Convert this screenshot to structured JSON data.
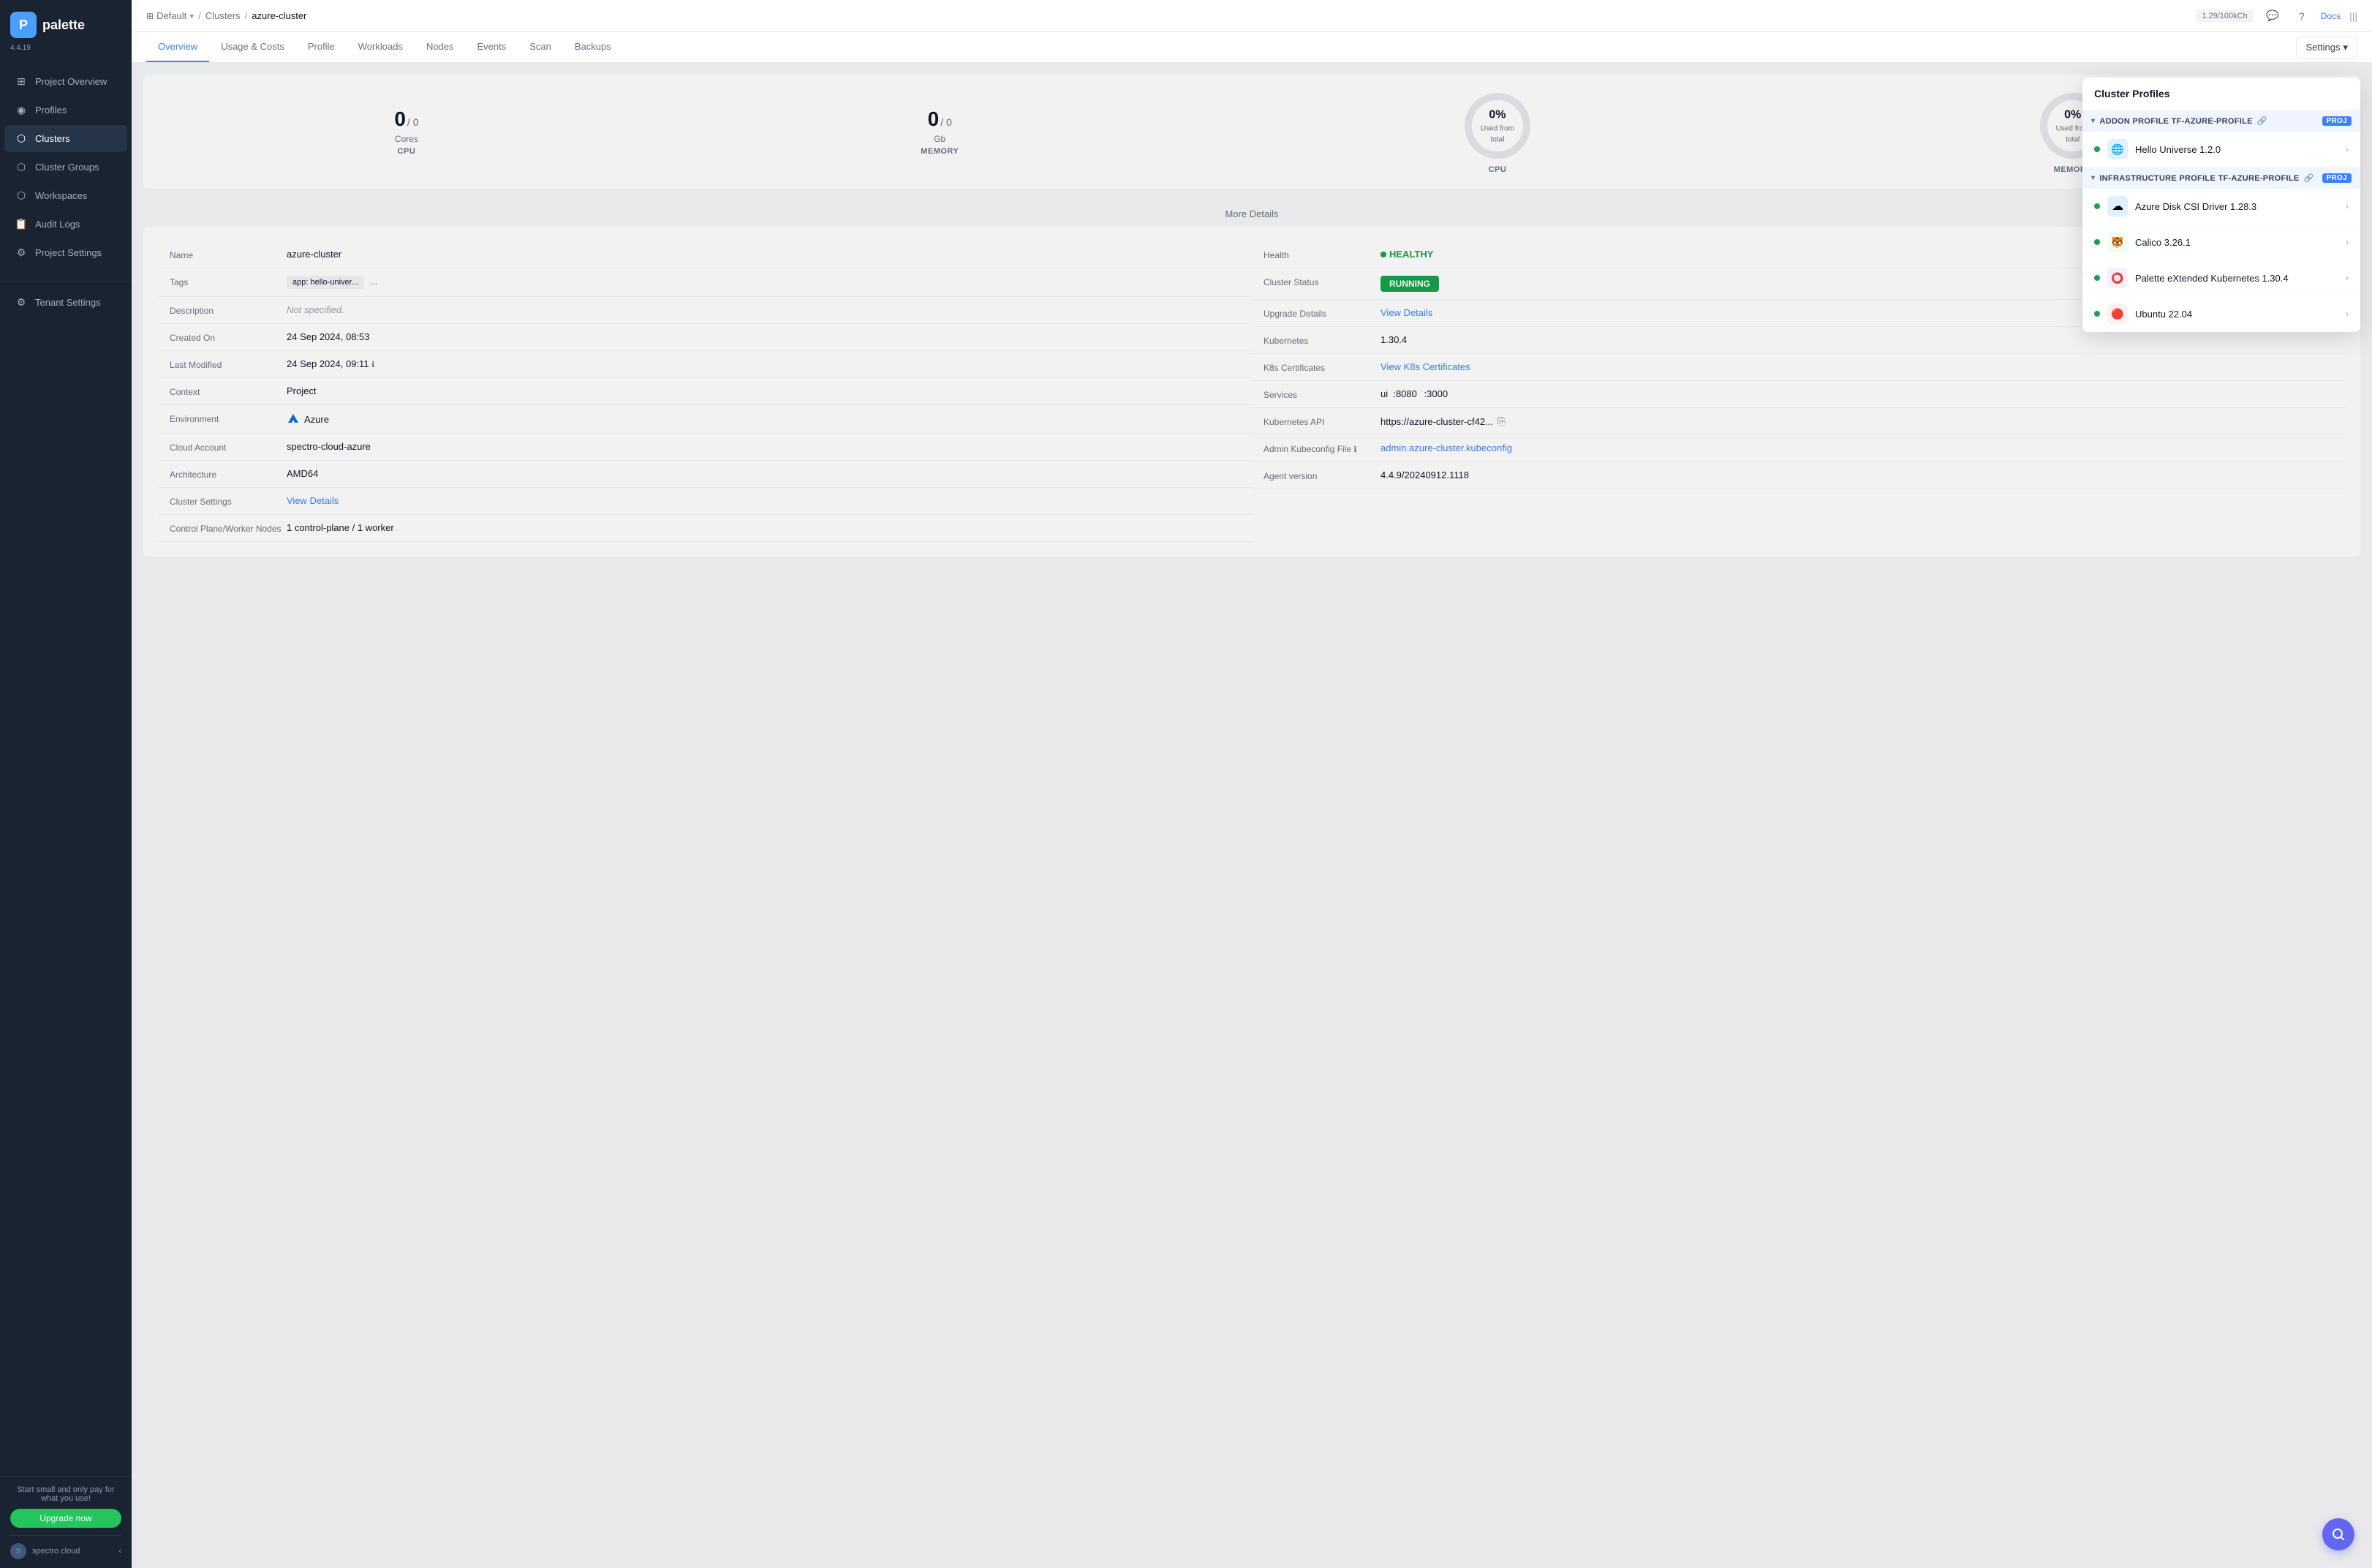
{
  "app": {
    "version": "4.4.19",
    "logo_letter": "P",
    "logo_text": "palette"
  },
  "sidebar": {
    "items": [
      {
        "id": "project-overview",
        "label": "Project Overview",
        "icon": "⊞"
      },
      {
        "id": "profiles",
        "label": "Profiles",
        "icon": "◉"
      },
      {
        "id": "clusters",
        "label": "Clusters",
        "icon": "⬡"
      },
      {
        "id": "cluster-groups",
        "label": "Cluster Groups",
        "icon": "⬡"
      },
      {
        "id": "workspaces",
        "label": "Workspaces",
        "icon": "⬡"
      },
      {
        "id": "audit-logs",
        "label": "Audit Logs",
        "icon": "📋"
      },
      {
        "id": "project-settings",
        "label": "Project Settings",
        "icon": "⚙"
      }
    ],
    "active_item": "clusters",
    "bottom": {
      "upgrade_text": "Start small and only pay for what you use!",
      "upgrade_btn": "Upgrade now",
      "spectro_label": "spectro cloud"
    },
    "tenant_settings": "Tenant Settings"
  },
  "topbar": {
    "workspace": "Default",
    "breadcrumb_clusters": "Clusters",
    "breadcrumb_current": "azure-cluster",
    "credits": "1.29/100kCh",
    "docs_label": "Docs"
  },
  "tabs": {
    "items": [
      "Overview",
      "Usage & Costs",
      "Profile",
      "Workloads",
      "Nodes",
      "Events",
      "Scan",
      "Backups"
    ],
    "active": "Overview",
    "settings_label": "Settings"
  },
  "overview": {
    "cpu_cores": "0",
    "cpu_total": "0",
    "cpu_unit": "Cores",
    "cpu_label": "CPU",
    "mem_gb": "0",
    "mem_total": "0",
    "mem_unit": "Gb",
    "mem_label": "MEMORY",
    "cpu_donut_pct": "0%",
    "cpu_donut_sub": "Used from total",
    "cpu_donut_label": "CPU",
    "mem_donut_pct": "0%",
    "mem_donut_sub": "Used from total",
    "mem_donut_label": "MEMORY",
    "more_details": "More Details"
  },
  "details": {
    "left": [
      {
        "label": "Name",
        "value": "azure-cluster",
        "type": "text"
      },
      {
        "label": "Tags",
        "value": "app: hello-univer...",
        "type": "tags"
      },
      {
        "label": "Description",
        "value": "Not specified.",
        "type": "gray"
      },
      {
        "label": "Created On",
        "value": "24 Sep 2024, 08:53",
        "type": "text"
      },
      {
        "label": "Last Modified",
        "value": "24 Sep 2024, 09:11",
        "type": "info"
      },
      {
        "label": "Context",
        "value": "Project",
        "type": "text"
      },
      {
        "label": "Environment",
        "value": "Azure",
        "type": "azure"
      },
      {
        "label": "Cloud Account",
        "value": "spectro-cloud-azure",
        "type": "text"
      },
      {
        "label": "Architecture",
        "value": "AMD64",
        "type": "text"
      },
      {
        "label": "Cluster Settings",
        "value": "View Details",
        "type": "link"
      },
      {
        "label": "Control Plane/Worker Nodes",
        "value": "1 control-plane / 1 worker",
        "type": "text"
      }
    ],
    "right": [
      {
        "label": "Health",
        "value": "HEALTHY",
        "type": "healthy"
      },
      {
        "label": "Cluster Status",
        "value": "RUNNING",
        "type": "status"
      },
      {
        "label": "Upgrade Details",
        "value": "View Details",
        "type": "link"
      },
      {
        "label": "Kubernetes",
        "value": "1.30.4",
        "type": "text"
      },
      {
        "label": "K8s Certificates",
        "value": "View K8s Certificates",
        "type": "link"
      },
      {
        "label": "Services",
        "value": "ui  :8080  :3000",
        "type": "text"
      },
      {
        "label": "Kubernetes API",
        "value": "https://azure-cluster-cf42...",
        "type": "copy"
      },
      {
        "label": "Admin Kubeconfig File",
        "value": "admin.azure-cluster.kubeconfig",
        "type": "link"
      },
      {
        "label": "Agent version",
        "value": "4.4.9/20240912.1118",
        "type": "text"
      }
    ]
  },
  "cluster_profiles": {
    "title": "Cluster Profiles",
    "addon_group": {
      "label": "ADDON PROFILE TF-AZURE-PROFILE",
      "badge": "PROJ",
      "items": [
        {
          "name": "Hello Universe 1.2.0",
          "icon": "🌐",
          "icon_bg": "#e0f2fe"
        }
      ]
    },
    "infra_group": {
      "label": "INFRASTRUCTURE PROFILE TF-AZURE-PROFILE",
      "badge": "PROJ",
      "items": [
        {
          "name": "Azure Disk CSI Driver 1.28.3",
          "icon": "☁",
          "icon_bg": "#e0f0ff"
        },
        {
          "name": "Calico 3.26.1",
          "icon": "🐯",
          "icon_bg": "#f0fff4"
        },
        {
          "name": "Palette eXtended Kubernetes 1.30.4",
          "icon": "⭕",
          "icon_bg": "#f5f0ff"
        },
        {
          "name": "Ubuntu 22.04",
          "icon": "🔴",
          "icon_bg": "#fff0f0"
        }
      ]
    }
  }
}
